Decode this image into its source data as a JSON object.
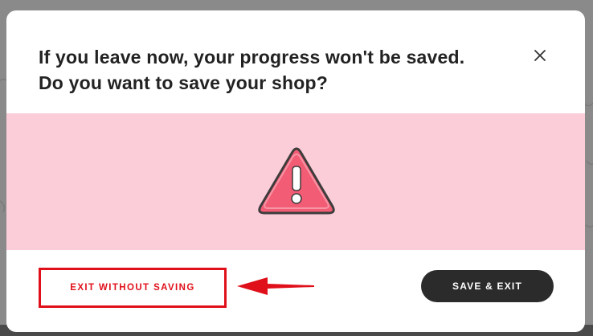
{
  "dialog": {
    "title_line1": "If you leave now, your progress won't be saved.",
    "title_line2": "Do you want to save your shop?",
    "close_icon": "close-icon",
    "warning_icon": "warning-triangle-icon",
    "banner_color": "#fbcdd8",
    "warning_color": "#f25c75"
  },
  "actions": {
    "exit_label": "EXIT WITHOUT SAVING",
    "save_label": "SAVE & EXIT",
    "highlight_color": "#e0101a",
    "arrow_icon": "pointer-arrow-icon"
  }
}
